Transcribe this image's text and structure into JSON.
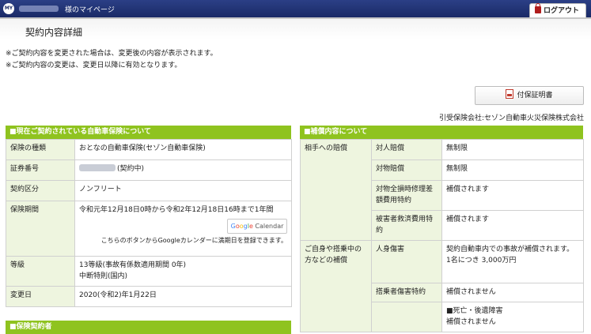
{
  "header": {
    "logo_text": "MY",
    "mypage_label": "様のマイページ",
    "logout_label": "ログアウト"
  },
  "page": {
    "title": "契約内容詳細",
    "notices": [
      "※ご契約内容を変更された場合は、変更後の内容が表示されます。",
      "※ご契約内容の変更は、変更日以降に有効となります。"
    ],
    "certificate_button": "付保証明書",
    "insurer": "引受保険会社:セゾン自動車火災保険株式会社"
  },
  "contract": {
    "heading": "■現在ご契約されている自動車保険について",
    "rows": [
      {
        "label": "保険の種類",
        "value": "おとなの自動車保険(セゾン自動車保険)"
      },
      {
        "label": "証券番号",
        "value": "(契約中)"
      },
      {
        "label": "契約区分",
        "value": "ノンフリート"
      },
      {
        "label": "保険期間",
        "value": "令和元年12月18日0時から令和2年12月18日16時まで1年間"
      },
      {
        "label": "等級",
        "value": "13等級(事故有係数適用期間 0年)",
        "value2": "中断特則(国内)"
      },
      {
        "label": "変更日",
        "value": "2020(令和2)年1月22日"
      }
    ],
    "gcal_label": "Google Calendar",
    "gcal_note": "こちらのボタンからGoogleカレンダーに満期日を登録できます。"
  },
  "coverage": {
    "heading": "■補償内容について",
    "groups": [
      {
        "label": "相手への賠償"
      },
      {
        "label": "ご自身や搭乗中の方などの補償"
      }
    ],
    "rows": [
      {
        "item": "対人賠償",
        "value": "無制限"
      },
      {
        "item": "対物賠償",
        "value": "無制限"
      },
      {
        "item": "対物全損時修理差額費用特約",
        "value": "補償されます"
      },
      {
        "item": "被害者救済費用特約",
        "value": "補償されます"
      },
      {
        "item": "人身傷害",
        "value": "契約自動車内での事故が補償されます。",
        "value2": "1名につき 3,000万円"
      },
      {
        "item": "搭乗者傷害特約",
        "value": "補償されません"
      },
      {
        "item": "",
        "value": "■死亡・後遺障害",
        "value2": "補償されません"
      }
    ]
  },
  "next_section": {
    "heading": "■保険契約者"
  }
}
